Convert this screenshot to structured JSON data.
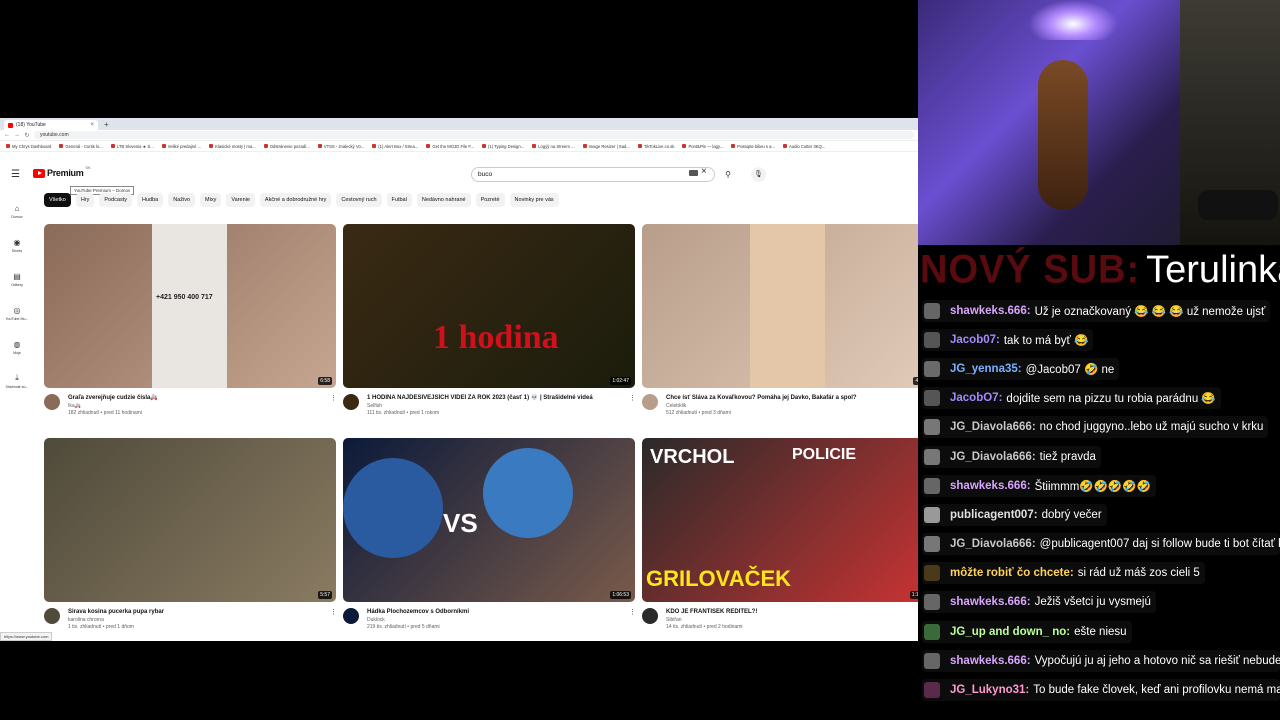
{
  "browser": {
    "tab_title": "(18) YouTube",
    "new_tab": "+",
    "address": "youtube.com",
    "nav": {
      "back": "←",
      "forward": "→",
      "reload": "↻"
    },
    "bookmarks": [
      "My Chrys Dashboard",
      "General - Curtis lo...",
      "LTB Slovenia ★ S...",
      "Veliké predajné ...",
      "Klasické mosty | ma...",
      "Odstránenie pozadí...",
      "VTSS - znalecký Vo...",
      "(1) Alert Box / Strea...",
      "Get the MOJO File F...",
      "(1) Typing Design...",
      "Logýý na Streem ...",
      "Image Resizer | Sad...",
      "TikTokLive.co.sk",
      "Pont&Ple — lagy...",
      "Postupte bilieu s a...",
      "Audio Cutter 3KQ..."
    ],
    "status_url": "https://www.youtube.com"
  },
  "yt": {
    "logo_text": "Premium",
    "logo_sup": "SK",
    "tooltip": "YouTube Premium – Domov",
    "search_value": "buco",
    "left_nav": [
      {
        "icon": "⌂",
        "label": "Domov"
      },
      {
        "icon": "◉",
        "label": "Shorts"
      },
      {
        "icon": "▤",
        "label": "Odbery"
      },
      {
        "icon": "◎",
        "label": "YouTube Mu..."
      },
      {
        "icon": "◍",
        "label": "Moje"
      },
      {
        "icon": "⤓",
        "label": "Stiahnuté sú..."
      }
    ],
    "chips": [
      "Všetko",
      "Hry",
      "Podcasty",
      "Hudba",
      "Naživo",
      "Mixy",
      "Varenie",
      "Akčné a dobrodružné hry",
      "Cestovný ruch",
      "Futbal",
      "Nedávno nahrané",
      "Pozreté",
      "Novinky pre vás"
    ],
    "videos": [
      {
        "title": "Graľa zverejňuje cudzie čísla🚑",
        "channel": "Ika🚑",
        "stats": "182 zhliadnutí • pred 11 hodinami",
        "duration": "6:58",
        "thumb": [
          "#8a6a58",
          "#c7a691"
        ]
      },
      {
        "title": "1 HODINA NAJDESIVEJŠÍCH VIDEÍ ZA ROK 2023 (časť 1) 💀 | Strašidelné videá",
        "channel": "Selfish",
        "stats": "111 tis. zhliadnutí • pred 1 rokom",
        "duration": "1:02:47",
        "thumb": [
          "#3a2a14",
          "#1b1c0c"
        ]
      },
      {
        "title": "Chce ísť Sláva za Kovaľkovou? Pomáha jej Davko, Bakafár a spol?",
        "channel": "Celebklik",
        "stats": "512 zhliadnutí • pred 3 dňami",
        "duration": "47:25",
        "thumb": [
          "#b89e8a",
          "#e2cbb9"
        ]
      },
      {
        "title": "Širava kosina pucerka pupa rybar",
        "channel": "karolina chrorna",
        "stats": "1 tis. zhliadnutí • pred 1 dňom",
        "duration": "5:57",
        "thumb": [
          "#4f4a3a",
          "#8a7b62"
        ]
      },
      {
        "title": "Hádka Plochozemcov s Odborníkmi",
        "channel": "Duklock",
        "stats": "219 tis. zhliadnutí • pred 5 dňami",
        "duration": "1:06:53",
        "thumb": [
          "#0b1a3a",
          "#7a5a4a"
        ]
      },
      {
        "title": "KDO JE FRANTIŠEK ŘEDITEL?!",
        "channel": "Sibiřan",
        "stats": "14 tis. zhliadnutí • pred 2 hodinami",
        "duration": "1:11:46",
        "thumb": [
          "#2a2a2a",
          "#c33"
        ]
      }
    ],
    "thumb_text": {
      "hodina": "1 hodina",
      "vrchol": "VRCHOL",
      "policie": "POLICIE",
      "grilovacek": "GRILOVAČEK",
      "vs": "VS",
      "phone_number": "+421 950 400 717"
    }
  },
  "sub_banner": {
    "label": "NOVÝ SUB:",
    "name": "Terulinka"
  },
  "chat": [
    {
      "user": "shawkeks.666:",
      "text": "Už je označkovaný 😂 😂 😂 už nemože ujsť",
      "color": "#d9a6ff",
      "avatar": "#666"
    },
    {
      "user": "Jacob07:",
      "text": "tak to má byť 😂",
      "color": "#a48aff",
      "avatar": "#555"
    },
    {
      "user": "JG_yenna35:",
      "text": "@Jacob07 🤣 ne",
      "color": "#7ab0ff",
      "avatar": "#6a6a6a"
    },
    {
      "user": "JacobO7:",
      "text": "dojdite sem na pizzu tu robia parádnu 😂",
      "color": "#a48aff",
      "avatar": "#555"
    },
    {
      "user": "JG_Diavola666:",
      "text": "no chod juggyno..lebo už majú sucho v krku",
      "color": "#c8c8c8",
      "avatar": "#777"
    },
    {
      "user": "JG_Diavola666:",
      "text": "tiež pravda",
      "color": "#c8c8c8",
      "avatar": "#777"
    },
    {
      "user": "shawkeks.666:",
      "text": "Štiimmm🤣🤣🤣🤣🤣",
      "color": "#d9a6ff",
      "avatar": "#666"
    },
    {
      "user": "publicagent007:",
      "text": "dobrý večer",
      "color": "#e0e0e0",
      "avatar": "#999"
    },
    {
      "user": "JG_Diavola666:",
      "text": "@publicagent007 daj si follow bude ti bot čítať komenty",
      "color": "#c8c8c8",
      "avatar": "#777"
    },
    {
      "user": "môžte robiť čo chcete:",
      "text": "si rád už máš zos cieli 5",
      "color": "#ffd25a",
      "avatar": "#4a3a1a"
    },
    {
      "user": "shawkeks.666:",
      "text": "Ježiš všetci ju vysmejú",
      "color": "#d9a6ff",
      "avatar": "#666"
    },
    {
      "user": "JG_up and down_ no:",
      "text": "ešte niesu",
      "color": "#b9ff9a",
      "avatar": "#3a6a3a"
    },
    {
      "user": "shawkeks.666:",
      "text": "Vypočujú ju aj jeho a hotovo nič sa riešiť nebude",
      "color": "#d9a6ff",
      "avatar": "#666"
    },
    {
      "user": "JG_Lukyno31:",
      "text": "To bude fake človek, keď ani profilovku nemá maskár",
      "color": "#ff9ad0",
      "avatar": "#5a2a4a"
    }
  ]
}
